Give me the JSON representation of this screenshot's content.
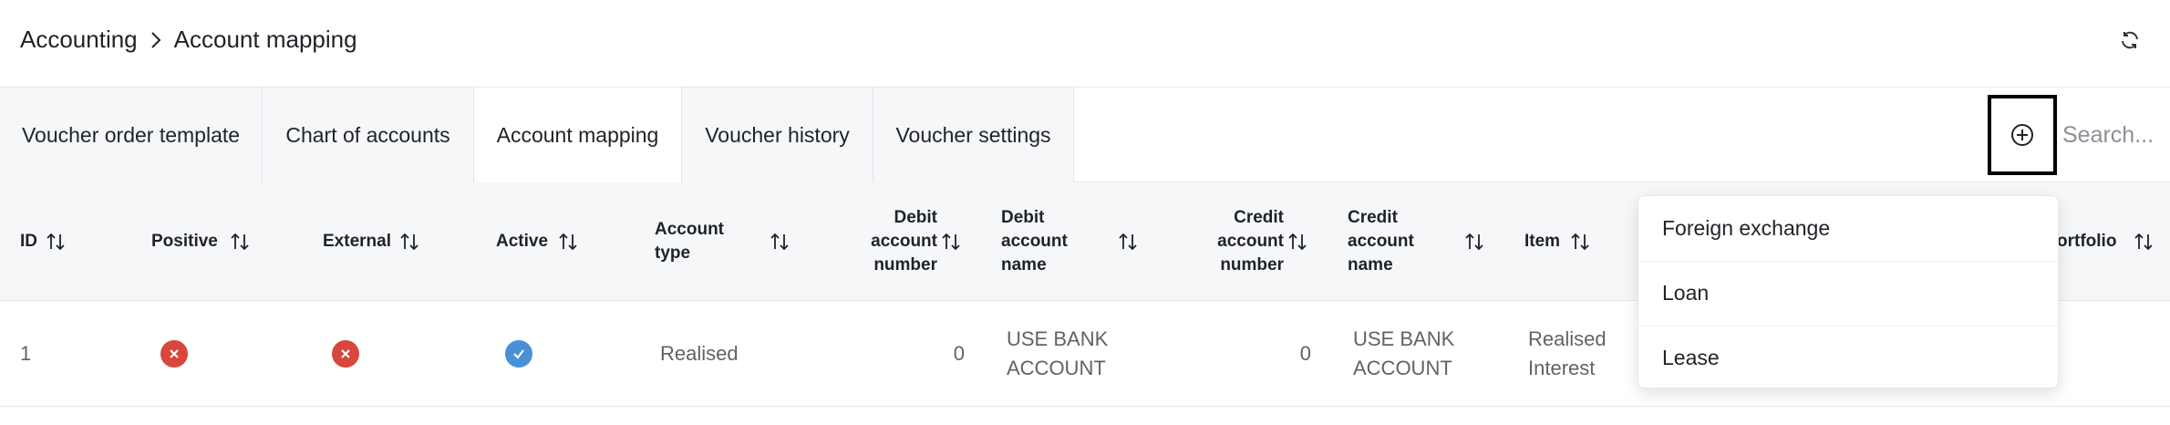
{
  "breadcrumb": {
    "parent": "Accounting",
    "current": "Account mapping"
  },
  "tabs": [
    {
      "label": "Voucher order template"
    },
    {
      "label": "Chart of accounts"
    },
    {
      "label": "Account mapping"
    },
    {
      "label": "Voucher history"
    },
    {
      "label": "Voucher settings"
    }
  ],
  "search": {
    "placeholder": "Search..."
  },
  "table": {
    "headers": {
      "id": "ID",
      "positive": "Positive",
      "external": "External",
      "active": "Active",
      "account_type_l1": "Account",
      "account_type_l2": "type",
      "debit_number_l1": "Debit",
      "debit_number_l2": "account",
      "debit_number_l3": "number",
      "debit_name_l1": "Debit",
      "debit_name_l2": "account",
      "debit_name_l3": "name",
      "credit_number_l1": "Credit",
      "credit_number_l2": "account",
      "credit_number_l3": "number",
      "credit_name_l1": "Credit",
      "credit_name_l2": "account",
      "credit_name_l3": "name",
      "item": "Item",
      "portfolio": "ortfolio"
    },
    "rows": [
      {
        "id": "1",
        "positive": "no",
        "external": "no",
        "active": "yes",
        "account_type": "Realised",
        "debit_account_number": "0",
        "debit_name_l1": "USE BANK",
        "debit_name_l2": "ACCOUNT",
        "credit_account_number": "0",
        "credit_name_l1": "USE BANK",
        "credit_name_l2": "ACCOUNT",
        "item_l1": "Realised",
        "item_l2": "Interest"
      }
    ]
  },
  "dropdown": {
    "items": [
      {
        "label": "Foreign exchange"
      },
      {
        "label": "Loan"
      },
      {
        "label": "Lease"
      }
    ]
  },
  "colors": {
    "negative": "#d9463b",
    "positive": "#4a90d9",
    "header_bg": "#f6f7f9"
  }
}
